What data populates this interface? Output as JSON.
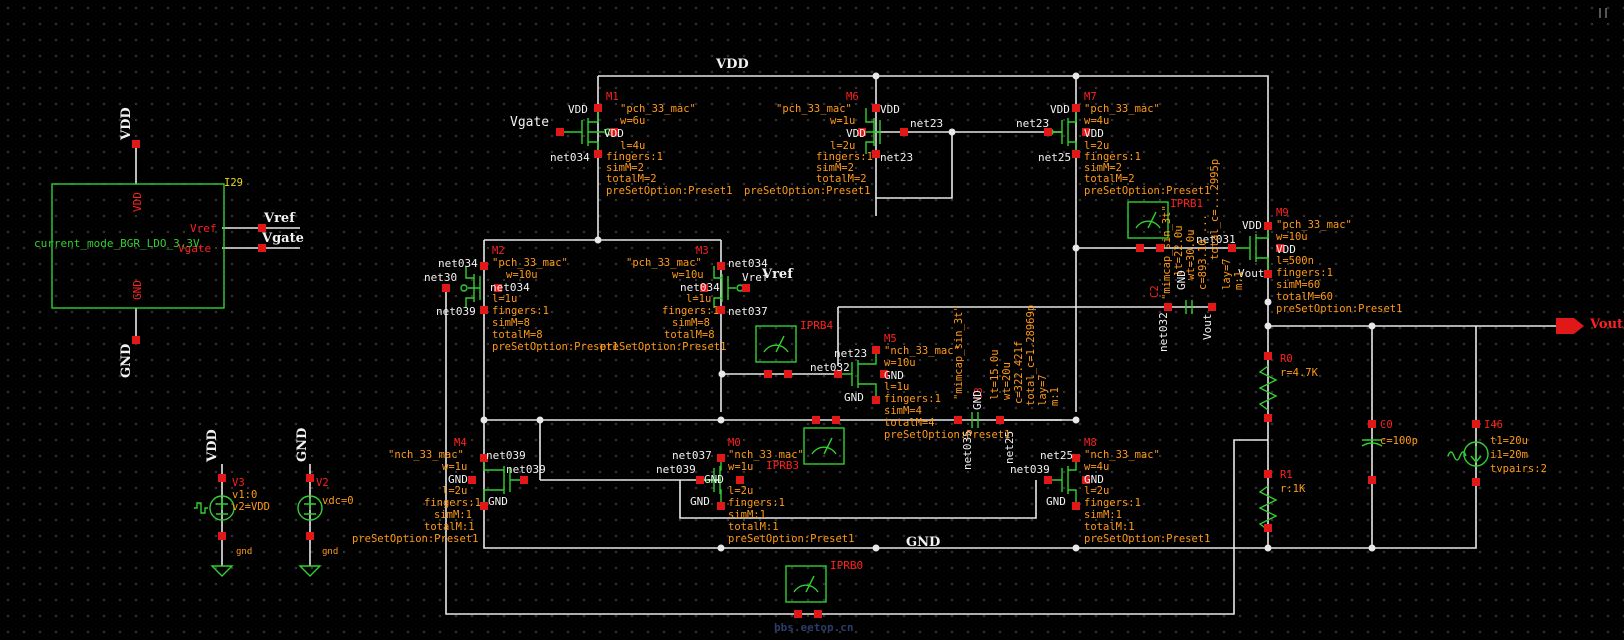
{
  "colors": {
    "background": "#000000",
    "wire": "#e8e8e8",
    "device": "#30d030",
    "pin": "#e01818",
    "param": "#ff9a18",
    "label": "#f2f2f2"
  },
  "nets": {
    "vdd": "VDD",
    "gnd": "GND",
    "vout": "Vout",
    "vref": "Vref",
    "vgate": "Vgate"
  },
  "block": {
    "inst": "I29",
    "name": "current_mode_BGR_LDO_3.3V",
    "vdd": "VDD",
    "gnd": "GND",
    "vref": "Vref",
    "vgate": "Vgate"
  },
  "rails": {
    "vdd_top": "VDD",
    "gnd_bottom": "GND",
    "vdd_left": "VDD",
    "gnd_left": "GND"
  },
  "m1": {
    "name": "M1",
    "model": "\"pch_33_mac\"",
    "w": "w=6u",
    "l": "l=4u",
    "fingers": "fingers:1",
    "simm": "simM=2",
    "totalm": "totalM=2",
    "preset": "preSetOption:Preset1",
    "p1": "VDD",
    "p2": "Vgate",
    "p3": "VDD",
    "p4": "net034"
  },
  "m6": {
    "name": "M6",
    "model": "\"pch_33_mac\"",
    "w": "w=1u",
    "l": "l=2u",
    "fingers": "fingers:1",
    "simm": "simM=2",
    "totalm": "totalM=2",
    "preset": "preSetOption:Preset1",
    "p1": "VDD",
    "p2": "VDD",
    "p3": "net23",
    "p4": "net23"
  },
  "m7": {
    "name": "M7",
    "model": "\"pch_33_mac\"",
    "w": "w=4u",
    "l": "l=2u",
    "fingers": "fingers:1",
    "simm": "simM=2",
    "totalm": "totalM=2",
    "preset": "preSetOption:Preset1",
    "p1": "VDD",
    "p2": "net23",
    "p3": "VDD",
    "p4": "net25"
  },
  "m2": {
    "name": "M2",
    "model": "\"pch_33_mac\"",
    "w": "w=10u",
    "l": "l=1u",
    "fingers": "fingers:1",
    "simm": "simM=8",
    "totalm": "totalM=8",
    "preset": "preSetOption:Preset1",
    "p1": "net034",
    "p2": "net30",
    "p3": "net034",
    "p4": "net039"
  },
  "m3": {
    "name": "M3",
    "model": "\"pch_33_mac\"",
    "w": "w=10u",
    "l": "l=1u",
    "fingers": "fingers:1",
    "simm": "simM=8",
    "totalm": "totalM=8",
    "preset": "preSetOption:Preset1",
    "p1": "net034",
    "p2": "Vref",
    "p3": "net034",
    "p4": "net037",
    "vref": "Vref"
  },
  "m9": {
    "name": "M9",
    "model": "\"pch_33_mac\"",
    "w": "w=10u",
    "l": "l=500n",
    "fingers": "fingers:1",
    "simm": "simM=60",
    "totalm": "totalM=60",
    "preset": "preSetOption:Preset1",
    "p1": "VDD",
    "p2": "net031",
    "p3": "VDD",
    "p4": "Vout"
  },
  "m5": {
    "name": "M5",
    "model": "\"nch_33_mac\"",
    "w": "w=10u",
    "l": "l=1u",
    "fingers": "fingers:1",
    "simm": "simM=4",
    "totalm": "totalM=4",
    "preset": "preSetOption:Preset1",
    "p1": "net23",
    "p2": "net032",
    "p3": "GND",
    "p4": "GND"
  },
  "m4": {
    "name": "M4",
    "model": "\"nch_33_mac\"",
    "w": "w=1u",
    "l": "l=2u",
    "fingers": "fingers:1",
    "simm": "simM:1",
    "totalm": "totalM:1",
    "preset": "preSetOption:Preset1",
    "p1": "net039",
    "p2": "net039",
    "p3": "GND",
    "p4": "GND"
  },
  "m0": {
    "name": "M0",
    "model": "\"nch_33_mac\"",
    "w": "w=1u",
    "l": "l=2u",
    "fingers": "fingers:1",
    "simm": "simM:1",
    "totalm": "totalM:1",
    "preset": "preSetOption:Preset1",
    "p1": "net037",
    "p2": "net039",
    "p3": "GND",
    "p4": "GND"
  },
  "m8": {
    "name": "M8",
    "model": "\"nch_33_mac\"",
    "w": "w=4u",
    "l": "l=2u",
    "fingers": "fingers:1",
    "simm": "simM:1",
    "totalm": "totalM:1",
    "preset": "preSetOption:Preset1",
    "p1": "net25",
    "p2": "net039",
    "p3": "GND",
    "p4": "GND"
  },
  "c2": {
    "name": "C2",
    "model": "\"mimcap_sin_3t\"",
    "lt": "lt=22.0u",
    "wt": "wt=30.0u",
    "c": "c=893.10 ...",
    "total": "total_c=...2995p",
    "lay": "lay=7",
    "m": "m:1",
    "gnd": "GND",
    "net": "net032",
    "vout": "Vout",
    "pin": "net031"
  },
  "c3": {
    "name": "C3",
    "model": "\"mimcap_sin_3t\"",
    "lt": "lt=15.0u",
    "wt": "wt=20u",
    "c": "c=322.421f",
    "total": "total_c=1.28969p",
    "lay": "lay=7",
    "m": "m:1",
    "gnd": "GND",
    "net1": "net035",
    "net2": "net25"
  },
  "probes": {
    "prb0": "IPRB0",
    "prb1": "IPRB1",
    "prb3": "IPRB3",
    "prb4": "IPRB4"
  },
  "r0": {
    "name": "R0",
    "value": "r=4.7K"
  },
  "r1": {
    "name": "R1",
    "value": "r:1K"
  },
  "c0": {
    "name": "C0",
    "value": "c=100p"
  },
  "i46": {
    "name": "I46",
    "t1": "t1=20u",
    "i1": "i1=20m",
    "tvpairs": "tvpairs:2"
  },
  "v3": {
    "name": "V3",
    "v1": "v1:0",
    "v2": "v2=VDD",
    "net": "VDD",
    "gnd": "gnd"
  },
  "v2": {
    "name": "V2",
    "vdc": "vdc=0",
    "net": "GND",
    "gnd": "gnd"
  },
  "watermark": "bbs.eetop.cn"
}
